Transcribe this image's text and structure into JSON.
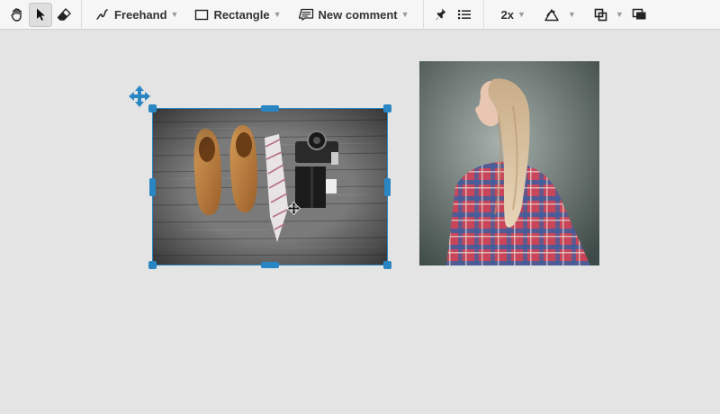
{
  "toolbar": {
    "tools": [
      {
        "name": "hand-tool",
        "icon": "hand-icon"
      },
      {
        "name": "select-tool",
        "icon": "arrow-pointer-icon",
        "active": true
      },
      {
        "name": "eraser-tool",
        "icon": "eraser-icon"
      }
    ],
    "freehand_label": "Freehand",
    "rectangle_label": "Rectangle",
    "comment_label": "New comment",
    "zoom_label": "2x"
  },
  "canvas": {
    "images": [
      {
        "subject": "shoes, tie and camera on wooden floor",
        "selected": true
      },
      {
        "subject": "woman in plaid shirt, side profile",
        "selected": false
      }
    ]
  },
  "colors": {
    "selection": "#2a86c2",
    "canvas_bg": "#e4e4e4",
    "toolbar_bg": "#f6f6f6"
  }
}
